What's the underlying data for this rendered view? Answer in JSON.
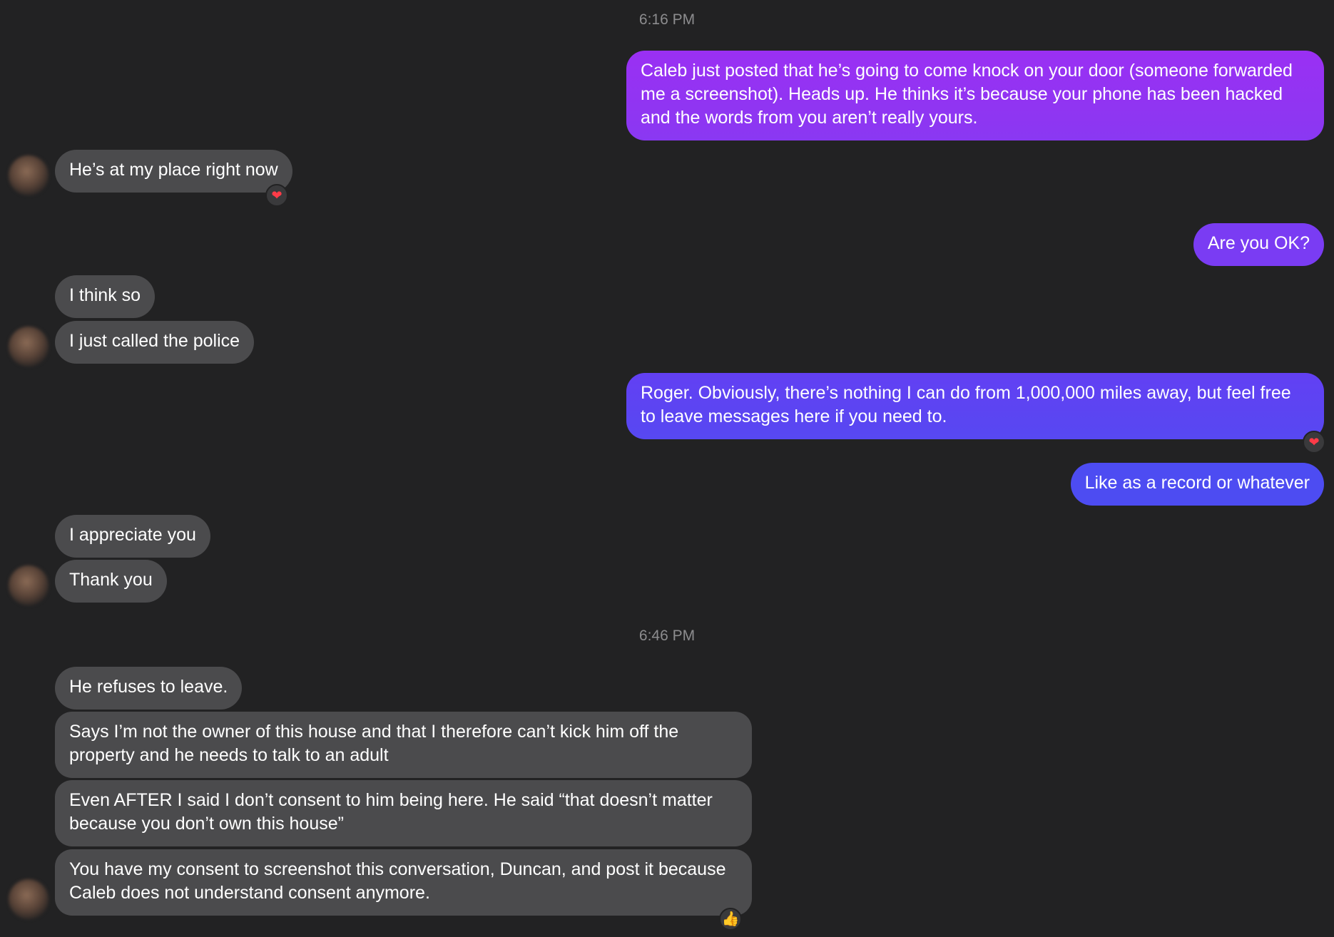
{
  "timestamps": [
    "6:16 PM",
    "6:46 PM"
  ],
  "colors": {
    "background": "#222223",
    "incoming_bubble": "#4b4b4d",
    "outgoing_gradient_top": "#9433f2",
    "outgoing_gradient_bottom": "#4a4ef2"
  },
  "messages": [
    {
      "from": "me",
      "text": "Caleb just posted that he’s going to come knock on your door (someone forwarded me a screenshot). Heads up. He thinks it’s because your phone has been hacked and the words from you aren’t really yours."
    },
    {
      "from": "them",
      "text": "He’s at my place right now",
      "reaction": "heart-icon"
    },
    {
      "from": "me",
      "text": "Are you OK?"
    },
    {
      "from": "them",
      "text": "I think so"
    },
    {
      "from": "them",
      "text": "I just called the police"
    },
    {
      "from": "me",
      "text": "Roger. Obviously, there’s nothing I can do from 1,000,000 miles away, but feel free to leave messages here if you need to.",
      "reaction": "heart-icon"
    },
    {
      "from": "me",
      "text": "Like as a record or whatever"
    },
    {
      "from": "them",
      "text": "I appreciate you"
    },
    {
      "from": "them",
      "text": "Thank you"
    },
    {
      "from": "them",
      "text": "He refuses to leave."
    },
    {
      "from": "them",
      "text": "Says I’m not the owner of this house and that I therefore can’t kick him off the property and he needs to talk to an adult"
    },
    {
      "from": "them",
      "text": "Even AFTER I said I don’t consent to him being here. He said “that doesn’t matter because you don’t own this house”"
    },
    {
      "from": "them",
      "text": "You have my consent to screenshot this conversation, Duncan, and post it because Caleb does not understand consent anymore.",
      "reaction": "thumbs-up-icon"
    }
  ],
  "reactions": {
    "heart": "❤",
    "thumbs_up": "👍"
  }
}
